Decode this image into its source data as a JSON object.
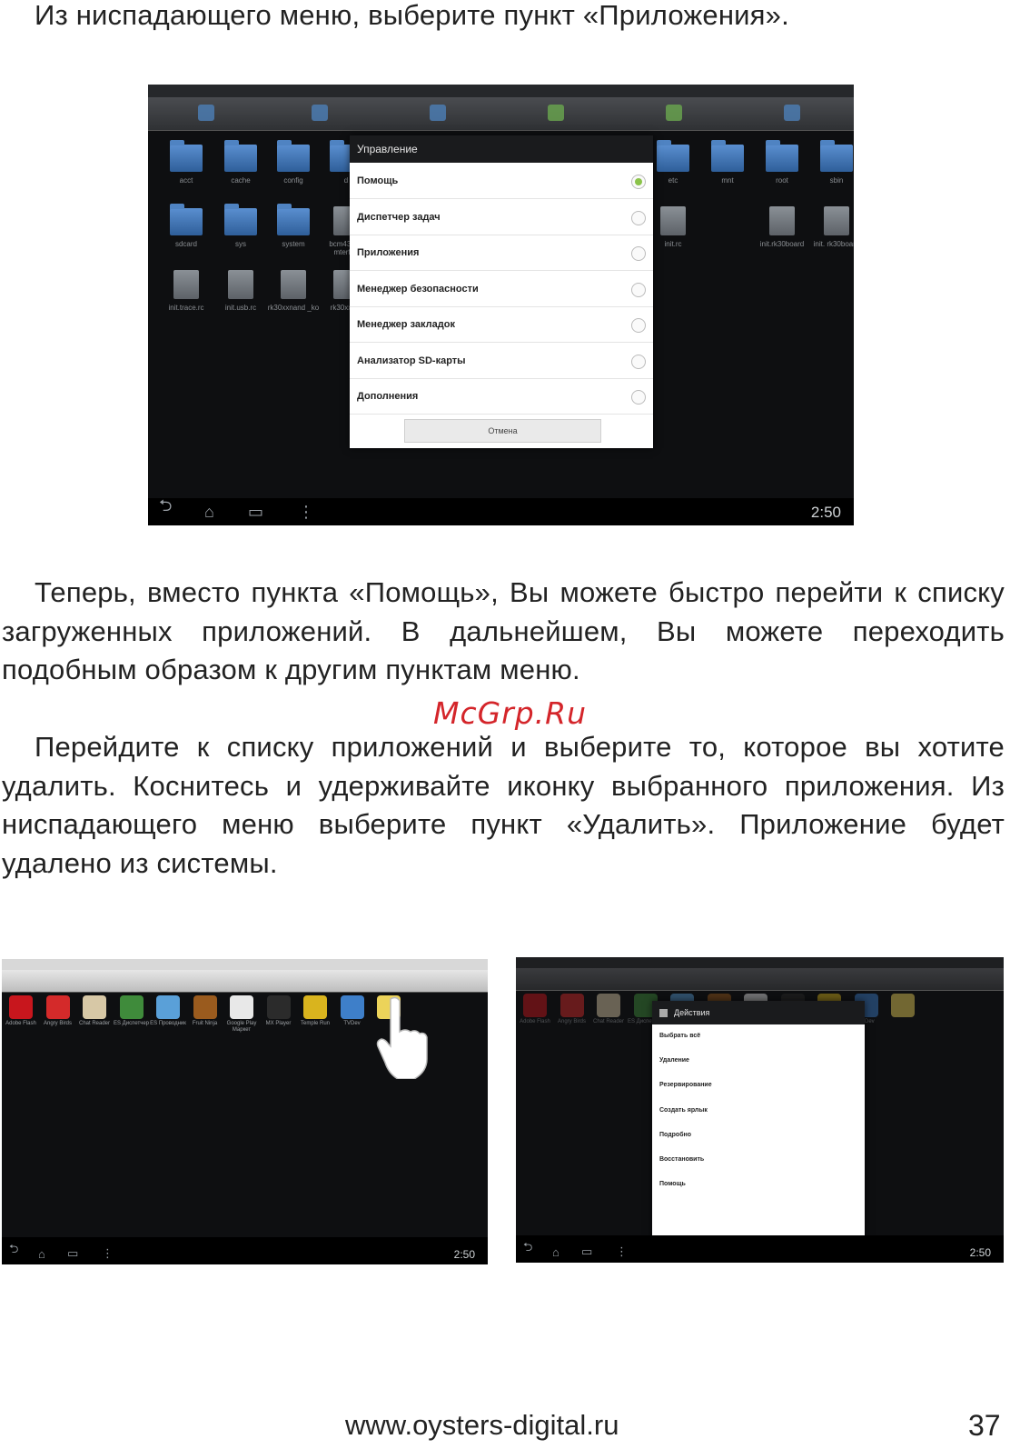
{
  "text": {
    "intro": "Из ниспадающего меню, выберите пункт «Приложения».",
    "para1": "Теперь, вместо пункта «Помощь», Вы можете быстро перейти к списку загруженных приложений. В дальнейшем, Вы можете переходить подобным образом к другим пунктам меню.",
    "watermark": "McGrp.Ru",
    "para2": "Перейдите к списку приложений и выберите то, которое вы хотите удалить. Коснитесь и удерживайте иконку выбранного приложения. Из ниспадающего меню выберите пункт «Удалить». Приложение будет удалено из системы.",
    "footer_url": "www.oysters-digital.ru",
    "page_number": "37"
  },
  "shot_top": {
    "clock": "2:50",
    "folders": [
      "acct",
      "cache",
      "config",
      "d",
      "etc",
      "mnt",
      "root",
      "sbin",
      "sdcard",
      "sys",
      "system",
      "vendor"
    ],
    "files": [
      "bcm4329_ mterfan",
      "init.rc",
      "init.rk30board",
      "init. rk30board",
      "init.trace.rc",
      "init.usb.rc",
      "rk30xxnand _ko",
      "rk30xxn..."
    ],
    "dialog_title": "Управление",
    "dialog_items": [
      "Помощь",
      "Диспетчер задач",
      "Приложения",
      "Менеджер безопасности",
      "Менеджер закладок",
      "Анализатор SD-карты",
      "Дополнения"
    ],
    "selected_item": 0,
    "dialog_button": "Отмена"
  },
  "shot_bl": {
    "clock": "2:50",
    "apps": [
      {
        "label": "Adobe Flash",
        "color": "#c8161d"
      },
      {
        "label": "Angry Birds",
        "color": "#d42a2a"
      },
      {
        "label": "Chat Reader",
        "color": "#d7c8a6"
      },
      {
        "label": "ES Диспетчер",
        "color": "#3f8b3b"
      },
      {
        "label": "ES Проводник",
        "color": "#5aa0d8"
      },
      {
        "label": "Fruit Ninja",
        "color": "#9a5b1e"
      },
      {
        "label": "Google Play Маркет",
        "color": "#e8e8e8"
      },
      {
        "label": "MX Player",
        "color": "#2b2b2b"
      },
      {
        "label": "Temple Run",
        "color": "#d9b41e"
      },
      {
        "label": "TVDev",
        "color": "#3e7fc9"
      },
      {
        "label": "",
        "color": "#ecd35a"
      }
    ]
  },
  "shot_br": {
    "clock": "2:50",
    "dialog_title": "Действия",
    "dialog_items": [
      "Выбрать всё",
      "Удаление",
      "Резервирование",
      "Создать ярлык",
      "Подробно",
      "Восстановить",
      "Помощь"
    ]
  },
  "colors": {
    "watermark": "#d4252a",
    "text": "#222222"
  }
}
